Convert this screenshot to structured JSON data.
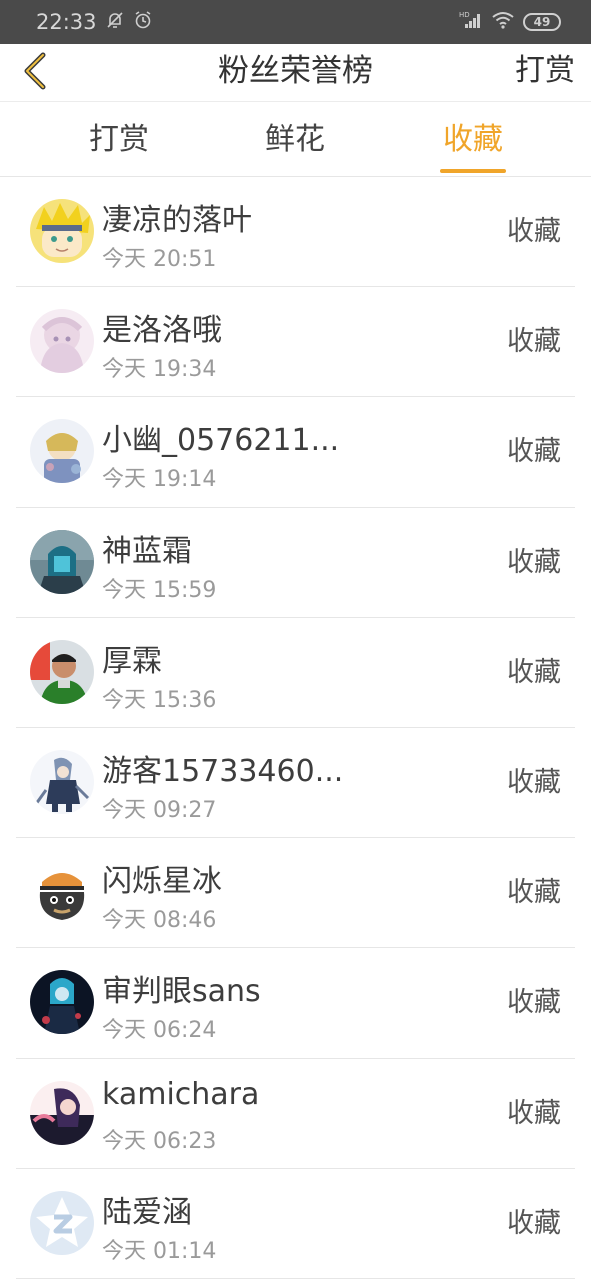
{
  "status_bar": {
    "time": "22:33",
    "battery": "49",
    "icons": [
      "mute-bell-icon",
      "alarm-icon",
      "hd-signal-icon",
      "wifi-icon",
      "battery-icon"
    ]
  },
  "header": {
    "title": "粉丝荣誉榜",
    "action_label": "打赏",
    "back_icon": "chevron-left-icon"
  },
  "tabs": [
    {
      "label": "打赏",
      "active": false
    },
    {
      "label": "鲜花",
      "active": false
    },
    {
      "label": "收藏",
      "active": true
    }
  ],
  "colors": {
    "accent": "#f0a52a",
    "status_bar": "#4a4a4a",
    "divider": "#e6e6e6"
  },
  "list": [
    {
      "name": "凄凉的落叶",
      "time": "今天 20:51",
      "type": "收藏"
    },
    {
      "name": "是洛洛哦",
      "time": "今天 19:34",
      "type": "收藏"
    },
    {
      "name": "小幽_0576211...",
      "time": "今天 19:14",
      "type": "收藏"
    },
    {
      "name": "神蓝霜",
      "time": "今天 15:59",
      "type": "收藏"
    },
    {
      "name": "厚霖",
      "time": "今天 15:36",
      "type": "收藏"
    },
    {
      "name": "游客15733460...",
      "time": "今天 09:27",
      "type": "收藏"
    },
    {
      "name": "闪烁星冰",
      "time": "今天 08:46",
      "type": "收藏"
    },
    {
      "name": "审判眼sans",
      "time": "今天 06:24",
      "type": "收藏"
    },
    {
      "name": "kamichara",
      "time": "今天 06:23",
      "type": "收藏"
    },
    {
      "name": "陆爱涵",
      "time": "今天 01:14",
      "type": "收藏"
    }
  ]
}
